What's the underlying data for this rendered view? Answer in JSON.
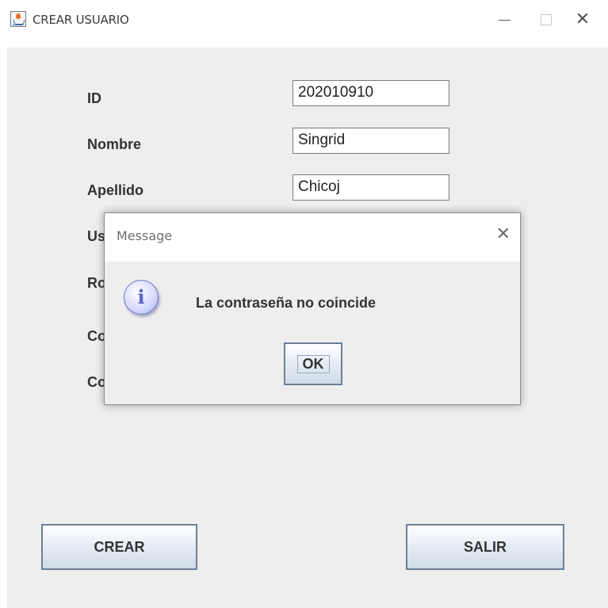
{
  "window": {
    "title": "CREAR USUARIO",
    "icon": "java-app-icon",
    "controls": [
      "minimize-icon",
      "maximize-icon",
      "close-icon"
    ],
    "close_glyph": "✕"
  },
  "form": {
    "labels": {
      "id": "ID",
      "nombre": "Nombre",
      "apellido": "Apellido",
      "usuario": "Us",
      "rol": "Ro",
      "contrasena": "Co",
      "confirmar": "Co"
    },
    "values": {
      "id": "202010910",
      "nombre": "Singrid",
      "apellido": "Chicoj"
    }
  },
  "buttons": {
    "crear": "CREAR",
    "salir": "SALIR"
  },
  "dialog": {
    "title": "Message",
    "close_glyph": "✕",
    "icon": "info-icon",
    "icon_glyph": "i",
    "message": "La contraseña no coincide",
    "ok": "OK"
  },
  "colors": {
    "content_bg": "#eeeeee",
    "button_border": "#6d7f95",
    "info_icon": "#5b63c7"
  }
}
